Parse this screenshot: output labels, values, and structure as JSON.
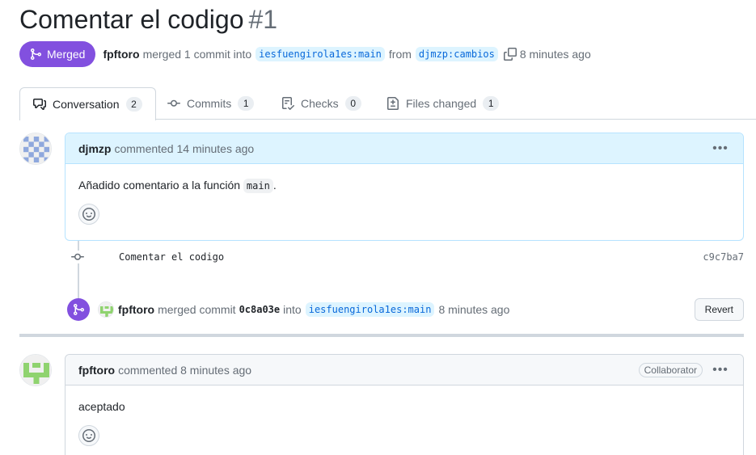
{
  "pr": {
    "title": "Comentar el codigo",
    "number": "#1",
    "state_label": "Merged",
    "merged_by": "fpftoro",
    "merge_text": "merged 1 commit into",
    "base_branch": "iesfuengirola1es:main",
    "from_text": "from",
    "head_branch": "djmzp:cambios",
    "time_ago": "8 minutes ago"
  },
  "tabs": [
    {
      "label": "Conversation",
      "count": "2",
      "icon": "comment-discussion-icon"
    },
    {
      "label": "Commits",
      "count": "1",
      "icon": "git-commit-icon"
    },
    {
      "label": "Checks",
      "count": "0",
      "icon": "checklist-icon"
    },
    {
      "label": "Files changed",
      "count": "1",
      "icon": "file-diff-icon"
    }
  ],
  "comments": [
    {
      "author": "djmzp",
      "action": "commented 14 minutes ago",
      "body_prefix": "Añadido comentario a la función",
      "body_code": "main",
      "body_suffix": "."
    },
    {
      "author": "fpftoro",
      "action": "commented 8 minutes ago",
      "role": "Collaborator",
      "body": "aceptado"
    }
  ],
  "commit": {
    "message": "Comentar el codigo",
    "sha": "c9c7ba7"
  },
  "merge_event": {
    "author": "fpftoro",
    "text": "merged commit",
    "sha": "0c8a03e",
    "into_text": "into",
    "branch": "iesfuengirola1es:main",
    "time_ago": "8 minutes ago",
    "revert_label": "Revert"
  },
  "colors": {
    "merged_purple": "#8250df",
    "link_blue": "#0969da",
    "branch_bg": "#ddf4ff",
    "avatar_djmzp": "#8fa8dd",
    "avatar_fpftoro": "#8fd36f"
  }
}
